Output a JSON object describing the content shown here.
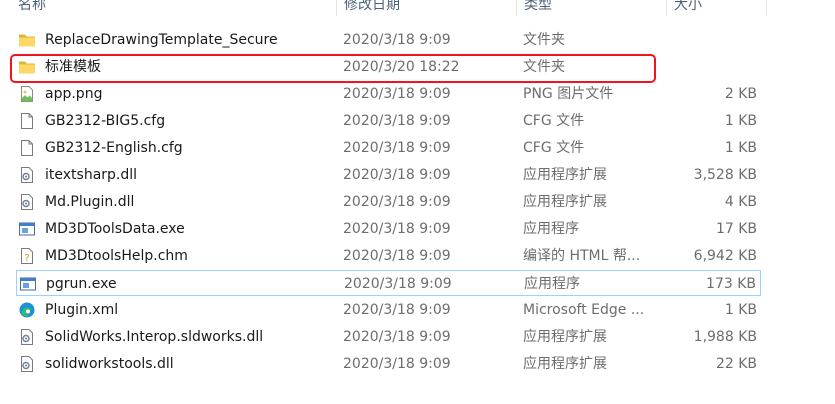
{
  "columns": {
    "name": "名称",
    "date": "修改日期",
    "type": "类型",
    "size": "大小"
  },
  "highlight_color": "#f0141e",
  "files": [
    {
      "name": "ReplaceDrawingTemplate_Secure",
      "date": "2020/3/18 9:09",
      "type": "文件夹",
      "size": "",
      "icon": "folder-icon"
    },
    {
      "name": "标准模板",
      "date": "2020/3/20 18:22",
      "type": "文件夹",
      "size": "",
      "icon": "folder-icon"
    },
    {
      "name": "app.png",
      "date": "2020/3/18 9:09",
      "type": "PNG 图片文件",
      "size": "2 KB",
      "icon": "image-file-icon"
    },
    {
      "name": "GB2312-BIG5.cfg",
      "date": "2020/3/18 9:09",
      "type": "CFG 文件",
      "size": "1 KB",
      "icon": "file-icon"
    },
    {
      "name": "GB2312-English.cfg",
      "date": "2020/3/18 9:09",
      "type": "CFG 文件",
      "size": "1 KB",
      "icon": "file-icon"
    },
    {
      "name": "itextsharp.dll",
      "date": "2020/3/18 9:09",
      "type": "应用程序扩展",
      "size": "3,528 KB",
      "icon": "dll-file-icon"
    },
    {
      "name": "Md.Plugin.dll",
      "date": "2020/3/18 9:09",
      "type": "应用程序扩展",
      "size": "4 KB",
      "icon": "dll-file-icon"
    },
    {
      "name": "MD3DToolsData.exe",
      "date": "2020/3/18 9:09",
      "type": "应用程序",
      "size": "17 KB",
      "icon": "exe-file-icon"
    },
    {
      "name": "MD3DtoolsHelp.chm",
      "date": "2020/3/18 9:09",
      "type": "编译的 HTML 帮...",
      "size": "6,942 KB",
      "icon": "help-file-icon"
    },
    {
      "name": "pgrun.exe",
      "date": "2020/3/18 9:09",
      "type": "应用程序",
      "size": "173 KB",
      "icon": "exe-file-icon"
    },
    {
      "name": "Plugin.xml",
      "date": "2020/3/18 9:09",
      "type": "Microsoft Edge ...",
      "size": "1 KB",
      "icon": "edge-file-icon"
    },
    {
      "name": "SolidWorks.Interop.sldworks.dll",
      "date": "2020/3/18 9:09",
      "type": "应用程序扩展",
      "size": "1,988 KB",
      "icon": "dll-file-icon"
    },
    {
      "name": "solidworkstools.dll",
      "date": "2020/3/18 9:09",
      "type": "应用程序扩展",
      "size": "22 KB",
      "icon": "dll-file-icon"
    }
  ]
}
